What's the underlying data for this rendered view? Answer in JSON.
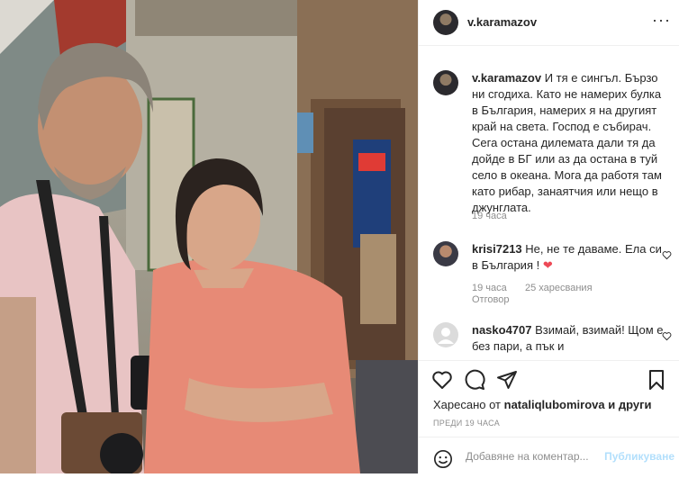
{
  "header": {
    "username": "v.karamazov",
    "more_icon": "more-dots-icon"
  },
  "caption": {
    "username": "v.karamazov",
    "text": "И тя е сингъл. Бързо ни сгодиха. Като не намерих булка в България, намерих я на другият край на света. Господ е събирач. Сега остана дилемата дали тя да дойде в БГ или аз да остана в туй село в океана. Мога да работя там като рибар, занаятчия или нещо в джунглата.",
    "time": "19 часа"
  },
  "comments": [
    {
      "username": "krisi7213",
      "text": "Не, не те даваме. Ела си в България !",
      "emoji": "❤",
      "time": "19 часа",
      "likes": "25 харесвания",
      "reply": "Отговор"
    },
    {
      "username": "nasko4707",
      "text": "Взимай, взимай! Щом е без пари, а пък и"
    }
  ],
  "likes": {
    "prefix": "Харесано от",
    "user": "nataliqlubomirova",
    "suffix": "и други"
  },
  "posted": "ПРЕДИ 19 ЧАСА",
  "add_comment": {
    "placeholder": "Добавяне на коментар...",
    "post_label": "Публикуване"
  },
  "icons": {
    "like": "heart-icon",
    "comment": "comment-bubble-icon",
    "share": "paper-plane-icon",
    "save": "bookmark-icon",
    "emoji": "emoji-smile-icon"
  },
  "colors": {
    "accent_disabled": "#b2dffc",
    "heart_red": "#ed4956",
    "muted": "#8e8e8e"
  }
}
